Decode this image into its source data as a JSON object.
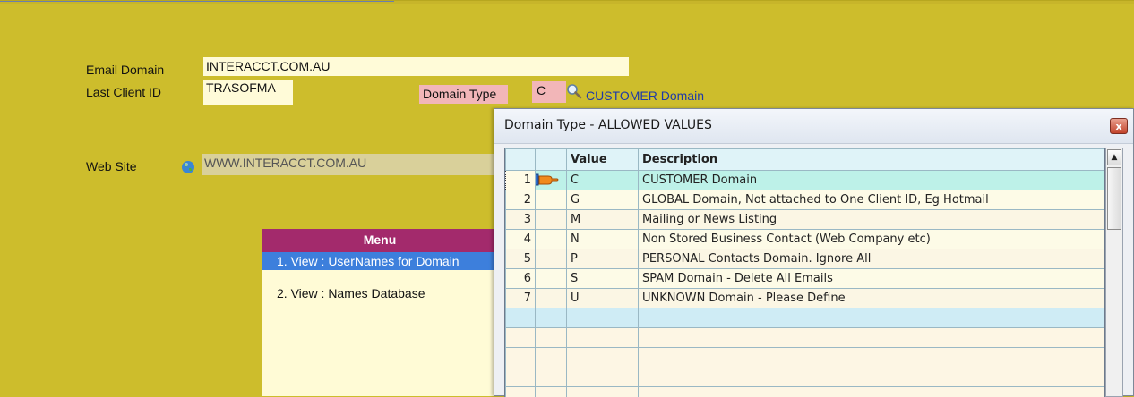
{
  "form": {
    "email_domain_label": "Email Domain",
    "email_domain_value": "INTERACCT.COM.AU",
    "last_client_label": "Last Client ID",
    "last_client_value": "TRASOFMA",
    "domain_type_label": "Domain Type",
    "domain_type_value": "C",
    "domain_type_desc": "CUSTOMER Domain",
    "web_site_label": "Web Site",
    "web_site_value": "WWW.INTERACCT.COM.AU"
  },
  "menu": {
    "title": "Menu",
    "items": [
      {
        "label": "1. View : UserNames for Domain"
      },
      {
        "label": "2. View : Names Database"
      }
    ]
  },
  "popup": {
    "title": "Domain Type - ALLOWED VALUES",
    "close_label": "x",
    "columns": [
      "",
      "",
      "Value",
      "Description"
    ],
    "rows": [
      {
        "num": "1",
        "value": "C",
        "desc": "CUSTOMER Domain"
      },
      {
        "num": "2",
        "value": "G",
        "desc": "GLOBAL Domain, Not attached to One Client ID, Eg Hotmail"
      },
      {
        "num": "3",
        "value": "M",
        "desc": "Mailing or News Listing"
      },
      {
        "num": "4",
        "value": "N",
        "desc": "Non Stored Business Contact (Web Company etc)"
      },
      {
        "num": "5",
        "value": "P",
        "desc": "PERSONAL Contacts Domain. Ignore All"
      },
      {
        "num": "6",
        "value": "S",
        "desc": "SPAM Domain - Delete All Emails"
      },
      {
        "num": "7",
        "value": "U",
        "desc": "UNKNOWN Domain - Please Define"
      }
    ]
  },
  "colors": {
    "background": "#cdbd2c",
    "menu_header": "#a32a6c",
    "selection": "#3d7fdc",
    "link": "#1e3aa8"
  }
}
